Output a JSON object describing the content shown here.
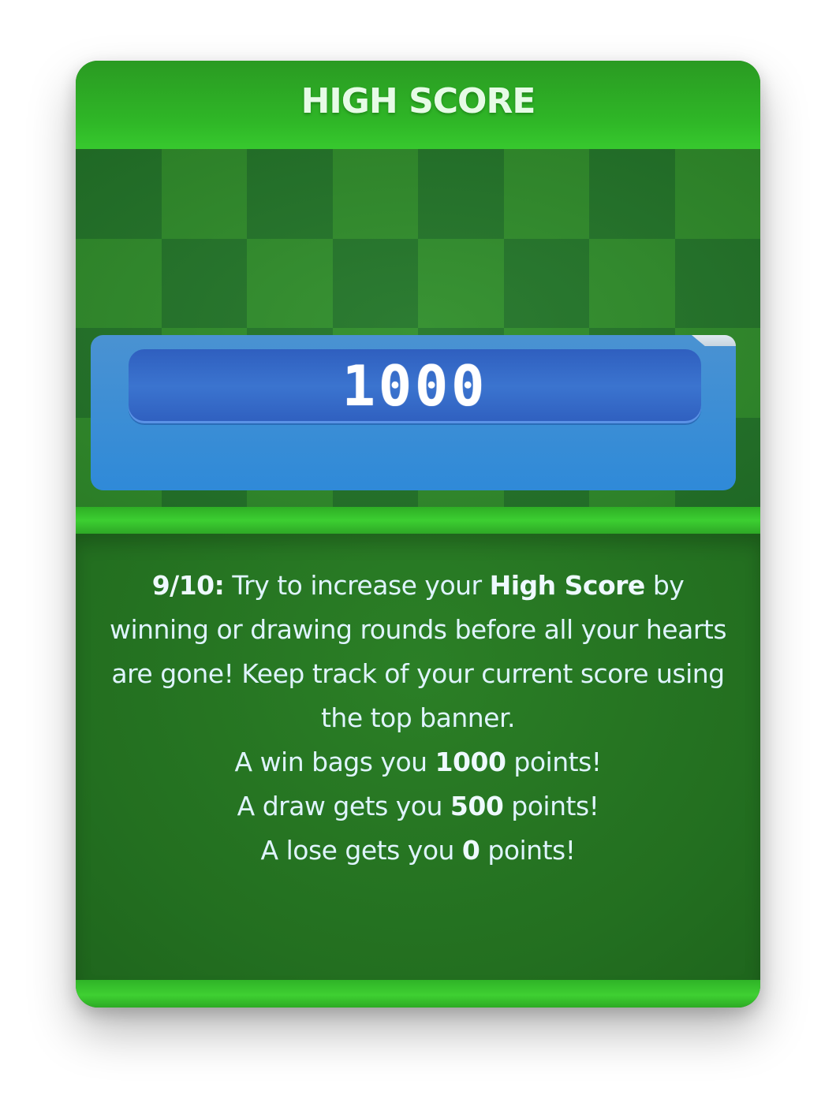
{
  "card": {
    "title": "HIGH SCORE"
  },
  "score": {
    "value": "1000"
  },
  "tip": {
    "step": "9/10:",
    "line1_a": " Try to increase your ",
    "line1_bold": "High Score",
    "line1_b": " by winning or drawing rounds before all your hearts are gone! Keep track of your current score using the top banner.",
    "win_a": "A win bags you ",
    "win_points": "1000",
    "win_b": " points!",
    "draw_a": "A draw gets you ",
    "draw_points": "500",
    "draw_b": " points!",
    "lose_a": "A lose gets you ",
    "lose_points": "0",
    "lose_b": " points!"
  },
  "colors": {
    "card_green": "#227a1f",
    "header_green": "#2fb727",
    "panel_blue": "#2f8ad8",
    "score_blue": "#3b74cf",
    "text": "#dff4ff"
  }
}
